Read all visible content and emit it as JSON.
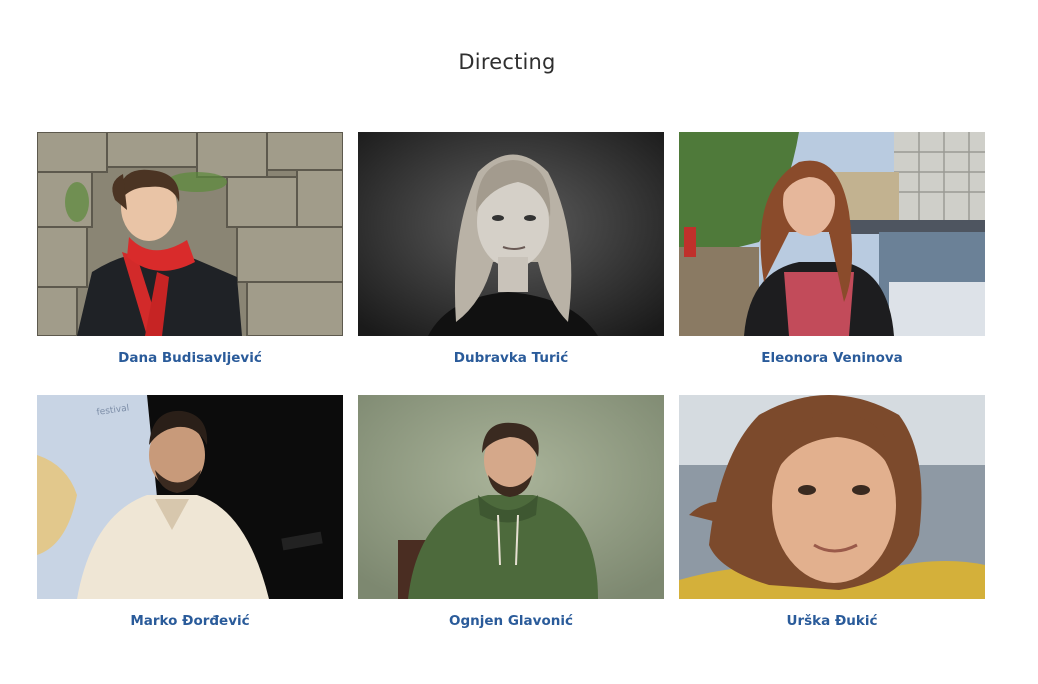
{
  "section": {
    "title": "Directing"
  },
  "people": [
    {
      "name": "Dana Budisavljević",
      "photo": "portrait-photo"
    },
    {
      "name": "Dubravka Turić",
      "photo": "portrait-photo"
    },
    {
      "name": "Eleonora Veninova",
      "photo": "portrait-photo"
    },
    {
      "name": "Marko Đorđević",
      "photo": "portrait-photo"
    },
    {
      "name": "Ognjen Glavonić",
      "photo": "portrait-photo"
    },
    {
      "name": "Urška Đukić",
      "photo": "portrait-photo"
    }
  ],
  "colors": {
    "name_link": "#2a5b9a",
    "title": "#2f2f2f"
  }
}
